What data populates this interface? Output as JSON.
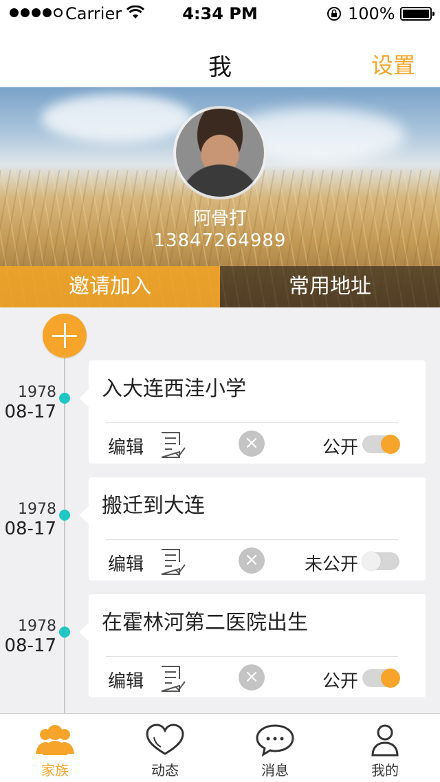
{
  "status_bar": {
    "carrier": "Carrier",
    "time": "4:34 PM",
    "battery": "100%",
    "signal_icon": "signal-dots-icon",
    "wifi_icon": "wifi-icon",
    "lock_icon": "rotation-lock-icon",
    "battery_icon": "battery-icon"
  },
  "nav": {
    "title": "我",
    "settings": "设置"
  },
  "profile": {
    "name": "阿骨打",
    "phone": "13847264989",
    "invite_button": "邀请加入",
    "address_button": "常用地址"
  },
  "timeline": {
    "add_icon": "plus-icon",
    "entries": [
      {
        "year": "1978",
        "date": "08-17",
        "text": "入大连西洼小学",
        "edit_label": "编辑",
        "visibility_label": "公开",
        "is_public": true
      },
      {
        "year": "1978",
        "date": "08-17",
        "text": "搬迁到大连",
        "edit_label": "编辑",
        "visibility_label": "未公开",
        "is_public": false
      },
      {
        "year": "1978",
        "date": "08-17",
        "text": "在霍林河第二医院出生",
        "edit_label": "编辑",
        "visibility_label": "公开",
        "is_public": true
      }
    ]
  },
  "tabbar": {
    "tabs": [
      {
        "label": "家族",
        "icon": "family-icon",
        "active": true
      },
      {
        "label": "动态",
        "icon": "heart-icon",
        "active": false
      },
      {
        "label": "消息",
        "icon": "chat-bubble-icon",
        "active": false
      },
      {
        "label": "我的",
        "icon": "person-icon",
        "active": false
      }
    ]
  },
  "colors": {
    "accent": "#f6a52a",
    "timeline_node": "#1fc7c4"
  }
}
